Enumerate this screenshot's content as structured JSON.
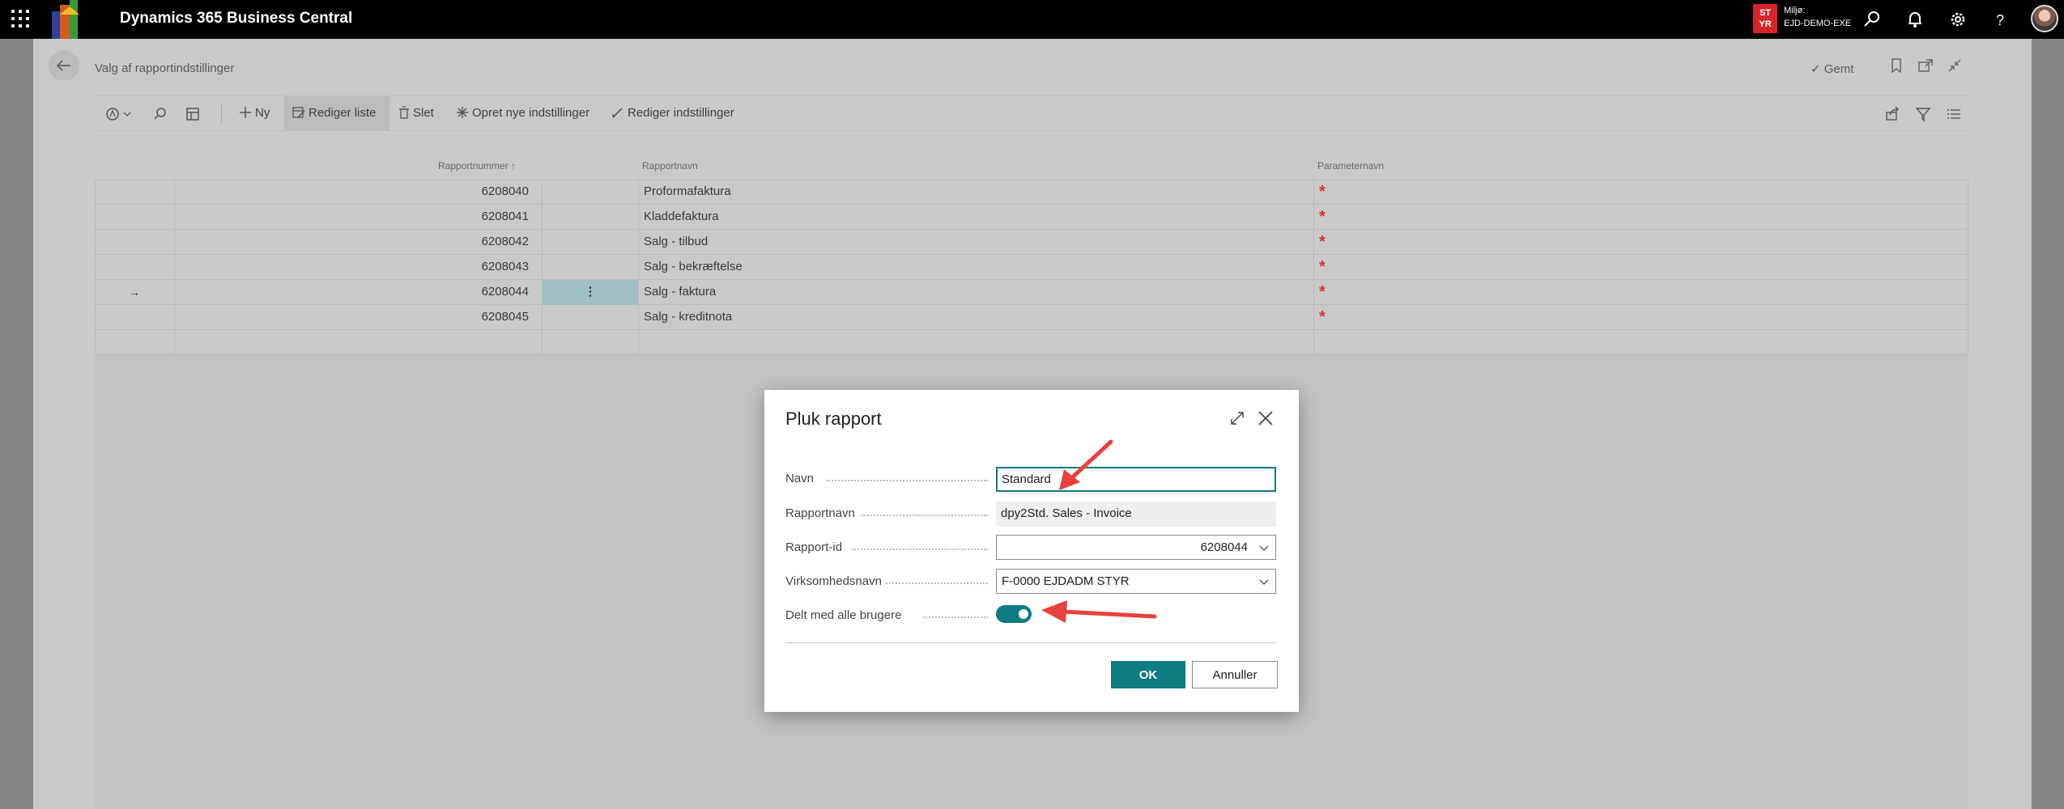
{
  "app": {
    "title": "Dynamics 365 Business Central",
    "environment_badge": "ST YR",
    "environment_label": "Miljø:",
    "environment_name": "EJD-DEMO-EXE"
  },
  "page": {
    "title": "Valg af rapportindstillinger",
    "saved_status": "Gemt"
  },
  "actions": {
    "new": "Ny",
    "edit_list": "Rediger liste",
    "delete": "Slet",
    "create_settings": "Opret nye indstillinger",
    "edit_settings": "Rediger indstillinger"
  },
  "table": {
    "columns": [
      "Rapportnummer",
      "Rapportnavn",
      "Parameternavn"
    ],
    "sort_indicator": "↑",
    "rows": [
      {
        "number": "6208040",
        "name": "Proformafaktura",
        "param": "*"
      },
      {
        "number": "6208041",
        "name": "Kladdefaktura",
        "param": "*"
      },
      {
        "number": "6208042",
        "name": "Salg - tilbud",
        "param": "*"
      },
      {
        "number": "6208043",
        "name": "Salg - bekræftelse",
        "param": "*"
      },
      {
        "number": "6208044",
        "name": "Salg - faktura",
        "param": "*",
        "selected": true
      },
      {
        "number": "6208045",
        "name": "Salg - kreditnota",
        "param": "*"
      }
    ],
    "row_indicator": "→",
    "row_menu": "⋮"
  },
  "dialog": {
    "title": "Pluk rapport",
    "fields": {
      "name_label": "Navn",
      "name_value": "Standard",
      "report_name_label": "Rapportnavn",
      "report_name_value": "dpy2Std. Sales - Invoice",
      "report_id_label": "Rapport-id",
      "report_id_value": "6208044",
      "company_label": "Virksomhedsnavn",
      "company_value": "F-0000 EJDADM STYR",
      "shared_label": "Delt med alle brugere",
      "shared_value": true
    },
    "ok_label": "OK",
    "cancel_label": "Annuller"
  },
  "colors": {
    "accent": "#0f7b82",
    "required": "#d13438",
    "annotation_arrow": "#e8413c"
  }
}
